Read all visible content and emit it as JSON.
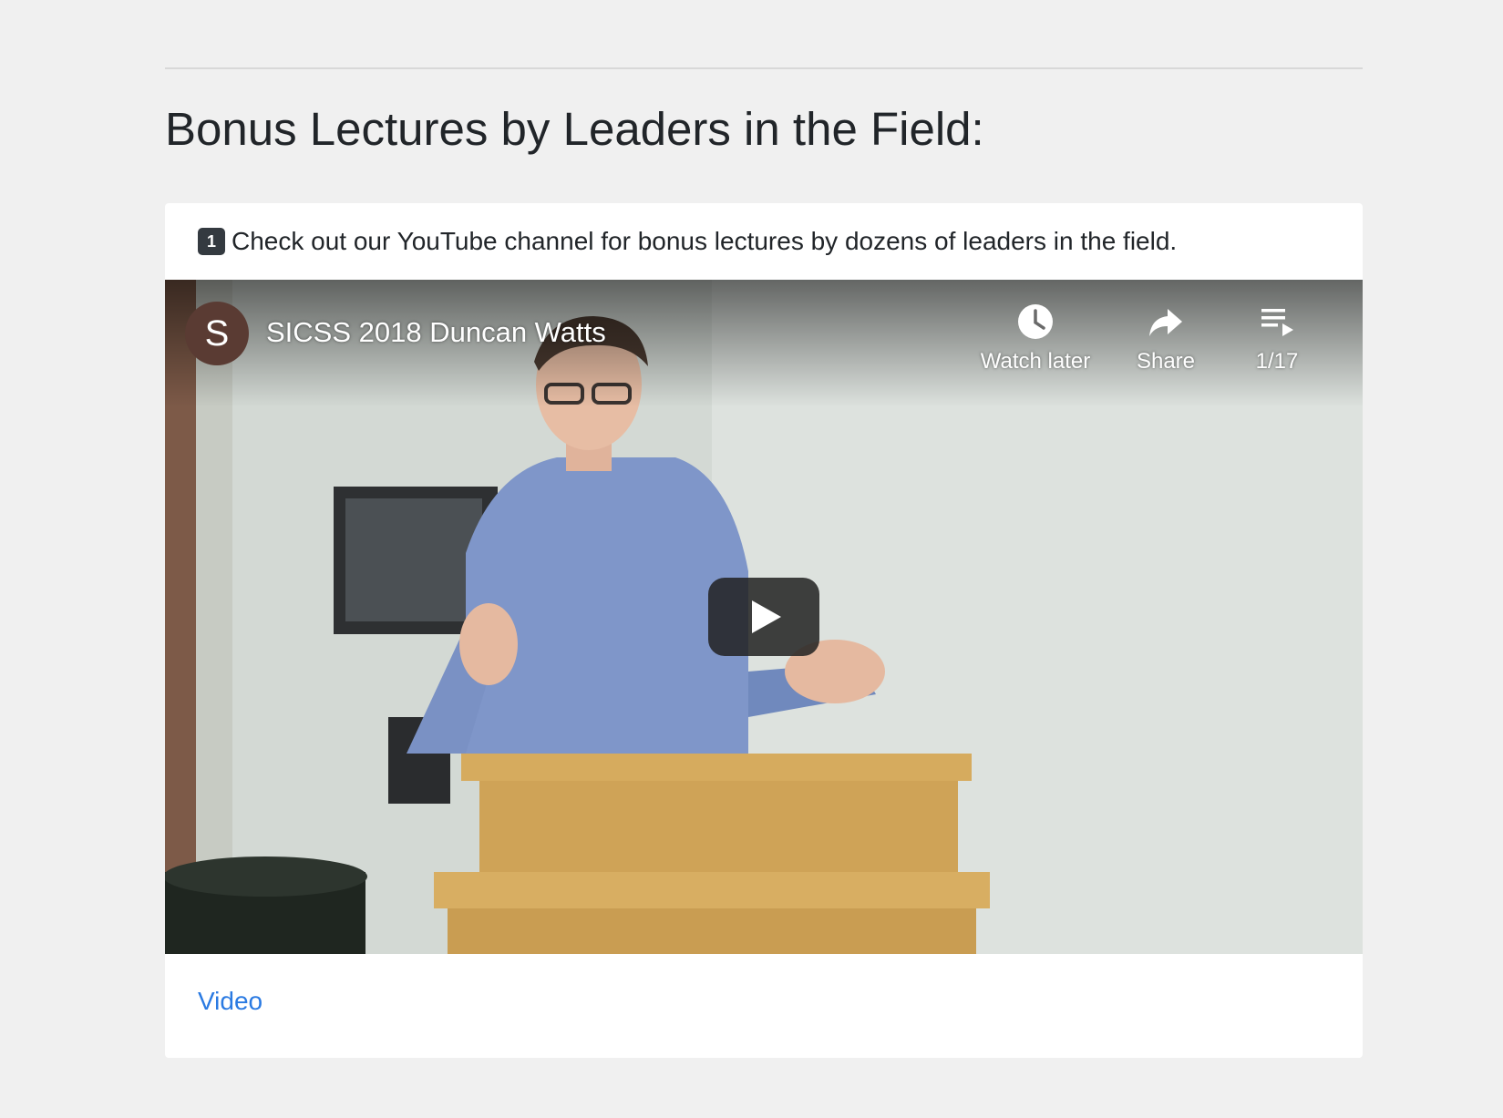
{
  "section": {
    "heading": "Bonus Lectures by Leaders in the Field:"
  },
  "card": {
    "badge_number": "1",
    "intro_text": "Check out our YouTube channel for bonus lectures by dozens of leaders in the field.",
    "link_label": "Video"
  },
  "video": {
    "channel_initial": "S",
    "title": "SICSS 2018 Duncan Watts",
    "controls": {
      "watch_later": "Watch later",
      "share": "Share",
      "playlist_position": "1/17"
    }
  },
  "colors": {
    "page_background": "#f0f0f0",
    "link": "#2a7ae2",
    "avatar": "#5a3b33",
    "badge": "#343a40"
  },
  "icons": [
    "clock-icon",
    "share-arrow-icon",
    "playlist-icon",
    "play-icon"
  ]
}
